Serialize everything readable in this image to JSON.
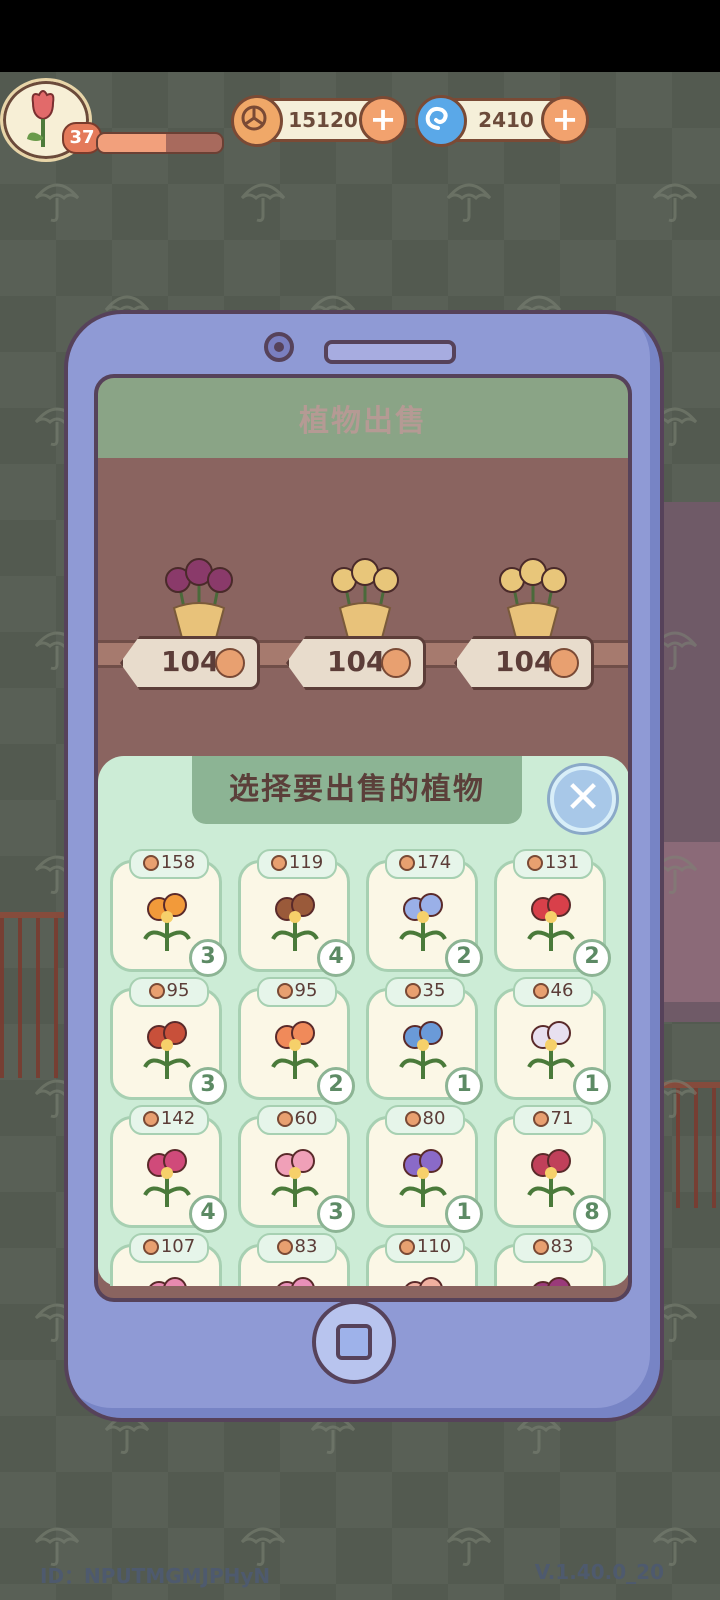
{
  "hud": {
    "level": "37",
    "xp_progress": 0.55,
    "coins": "15120",
    "gems": "2410"
  },
  "screen": {
    "title": "植物出售",
    "for_sale": [
      {
        "price": "104",
        "flower_color": "#8a3a6a"
      },
      {
        "price": "104",
        "flower_color": "#e8c67a"
      },
      {
        "price": "104",
        "flower_color": "#e8c67a"
      }
    ]
  },
  "panel": {
    "title": "选择要出售的植物",
    "close_label": "✕",
    "items": [
      {
        "price": "158",
        "count": "3",
        "color": "#f29a3a"
      },
      {
        "price": "119",
        "count": "4",
        "color": "#9a5a3a"
      },
      {
        "price": "174",
        "count": "2",
        "color": "#9ab0e8"
      },
      {
        "price": "131",
        "count": "2",
        "color": "#d8404a"
      },
      {
        "price": "95",
        "count": "3",
        "color": "#c8503a"
      },
      {
        "price": "95",
        "count": "2",
        "color": "#f08a5a"
      },
      {
        "price": "35",
        "count": "1",
        "color": "#6a9ad8"
      },
      {
        "price": "46",
        "count": "1",
        "color": "#e8e0f0"
      },
      {
        "price": "142",
        "count": "4",
        "color": "#d04a7a"
      },
      {
        "price": "60",
        "count": "3",
        "color": "#f0a0b8"
      },
      {
        "price": "80",
        "count": "1",
        "color": "#8a6ac8"
      },
      {
        "price": "71",
        "count": "8",
        "color": "#c0405a"
      },
      {
        "price": "107",
        "count": "",
        "color": "#e88ab0"
      },
      {
        "price": "83",
        "count": "",
        "color": "#e890b8"
      },
      {
        "price": "110",
        "count": "",
        "color": "#f0b0a0"
      },
      {
        "price": "83",
        "count": "",
        "color": "#9a3a7a"
      }
    ]
  },
  "footer": {
    "id": "ID：NPUTMGMJPHyN",
    "version": "V.1.40.0_20"
  },
  "colors": {
    "background": "#535a50",
    "phone": "#8f9ad5",
    "panel": "#ccecd6",
    "panel_title": "#8cb494"
  }
}
